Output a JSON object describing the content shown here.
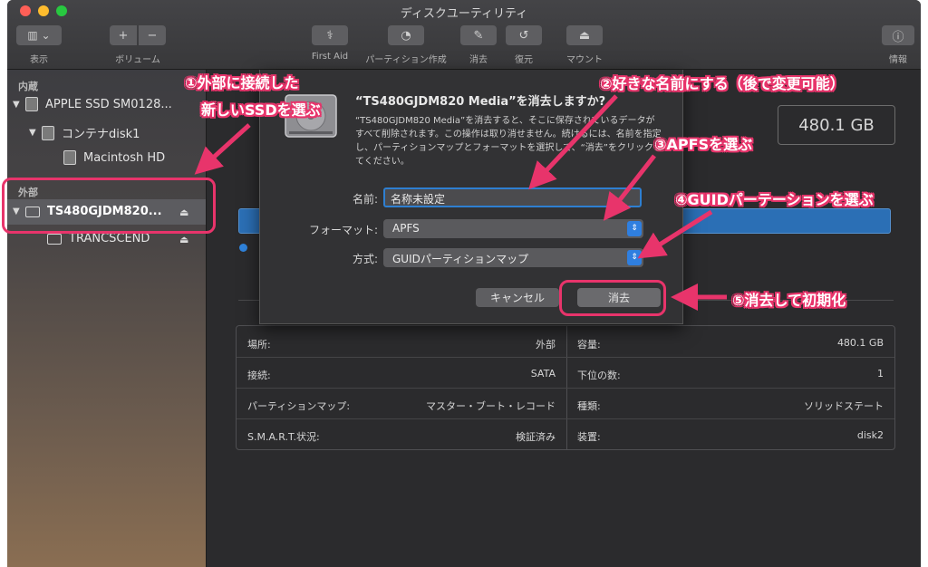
{
  "window": {
    "title": "ディスクユーティリティ"
  },
  "toolbar": {
    "view_label": "表示",
    "volume_label": "ボリューム",
    "plus": "+",
    "minus": "−",
    "first_aid": "First Aid",
    "partition": "パーティション作成",
    "erase": "消去",
    "restore": "復元",
    "mount": "マウント",
    "info": "情報"
  },
  "sidebar": {
    "internal_header": "内蔵",
    "external_header": "外部",
    "items": [
      {
        "label": "APPLE SSD SM0128..."
      },
      {
        "label": "コンテナdisk1"
      },
      {
        "label": "Macintosh HD"
      },
      {
        "label": "TS480GJDM820..."
      },
      {
        "label": "TRANCSCEND"
      }
    ]
  },
  "main": {
    "capacity": "480.1 GB",
    "info": {
      "location_label": "場所:",
      "location_value": "外部",
      "connection_label": "接続:",
      "connection_value": "SATA",
      "partmap_label": "パーティションマップ:",
      "partmap_value": "マスター・ブート・レコード",
      "smart_label": "S.M.A.R.T.状況:",
      "smart_value": "検証済み",
      "capacity_label": "容量:",
      "capacity_value": "480.1 GB",
      "children_label": "下位の数:",
      "children_value": "1",
      "type_label": "種類:",
      "type_value": "ソリッドステート",
      "device_label": "装置:",
      "device_value": "disk2"
    }
  },
  "dialog": {
    "title": "“TS480GJDM820 Media”を消去しますか?",
    "body": "“TS480GJDM820 Media”を消去すると、そこに保存されているデータがすべて削除されます。この操作は取り消せません。続けるには、名前を指定し、パーティションマップとフォーマットを選択して、“消去”をクリックしてください。",
    "name_label": "名前:",
    "name_value": "名称未設定",
    "format_label": "フォーマット:",
    "format_value": "APFS",
    "scheme_label": "方式:",
    "scheme_value": "GUIDパーティションマップ",
    "cancel": "キャンセル",
    "erase": "消去"
  },
  "annotations": {
    "step1_line1": "①外部に接続した",
    "step1_line2": "新しいSSDを選ぶ",
    "step2": "②好きな名前にする（後で変更可能）",
    "step3": "③APFSを選ぶ",
    "step4": "④GUIDパーテーションを選ぶ",
    "step5": "⑤消去して初期化",
    "color": "#e8346b"
  }
}
